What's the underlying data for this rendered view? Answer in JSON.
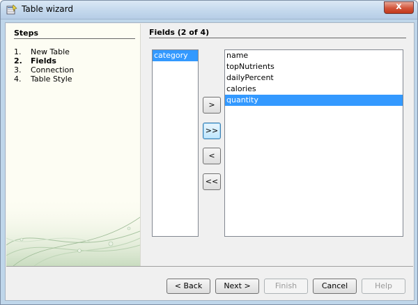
{
  "window": {
    "title": "Table wizard",
    "close_glyph": "x"
  },
  "steps": {
    "title": "Steps",
    "items": [
      {
        "num": "1.",
        "label": "New Table"
      },
      {
        "num": "2.",
        "label": "Fields"
      },
      {
        "num": "3.",
        "label": "Connection"
      },
      {
        "num": "4.",
        "label": "Table Style"
      }
    ],
    "active_step": 2
  },
  "fields": {
    "title": "Fields (2 of 4)",
    "selected_list": [
      "category"
    ],
    "available_list": [
      "name",
      "topNutrients",
      "dailyPercent",
      "calories",
      "quantity"
    ],
    "available_selected": "quantity"
  },
  "move_buttons": {
    "add": ">",
    "add_all": ">>",
    "remove": "<",
    "remove_all": "<<"
  },
  "footer": {
    "back": "< Back",
    "next": "Next >",
    "finish": "Finish",
    "cancel": "Cancel",
    "help": "Help"
  },
  "colors": {
    "selection": "#3399ff",
    "titlebar": "#c2d7ec",
    "close_button": "#c1391c"
  }
}
